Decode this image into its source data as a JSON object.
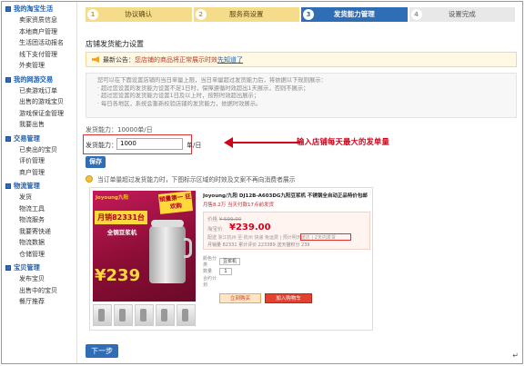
{
  "sidebar": {
    "groups": [
      {
        "title": "我的淘宝生活",
        "items": [
          "卖家资质信息",
          "本地商户管理",
          "生活团活动报名",
          "线下支付管理",
          "外卖管理"
        ]
      },
      {
        "title": "我的网游交易",
        "items": [
          "已卖游戏订单",
          "出售的游戏宝贝",
          "游戏保证金管理",
          "我要出售"
        ]
      },
      {
        "title": "交易管理",
        "items": [
          "已卖出的宝贝",
          "评价管理",
          "商户管理"
        ]
      },
      {
        "title": "物流管理",
        "items": [
          "发货",
          "物流工具",
          "物流服务",
          "我要寄快递",
          "物流数据",
          "仓储管理"
        ]
      },
      {
        "title": "宝贝管理",
        "items": [
          "发布宝贝",
          "出售中的宝贝",
          "餐厅推荐"
        ]
      }
    ]
  },
  "steps": [
    {
      "num": "1",
      "label": "协议确认"
    },
    {
      "num": "2",
      "label": "服务商设置"
    },
    {
      "num": "3",
      "label": "发货能力管理"
    },
    {
      "num": "4",
      "label": "设置完成"
    }
  ],
  "page_title": "店铺发货能力设置",
  "notice": {
    "label": "最新公告：",
    "text": "您店铺的商品将正常展示时效",
    "link": "先知道了"
  },
  "info_rows": [
    "您可以在下面设置店铺的当日单量上限，当日单量超过发货能力后，将依据以下规则展示：",
    "· 超过您设置的发货能力设置不足1日时，保障遵循时效超出1天展示，否则不展示；",
    "· 超过您设置的发货能力设置1日及以上时，按照时效超出展示；",
    "· 每日各地区，系统会重新校验店铺的发货能力，依据时效展示。"
  ],
  "capacity": {
    "current_label": "发货能力：",
    "current_value": "10000单/日",
    "input_label": "发货能力：",
    "input_value": "1000",
    "unit": "单/日"
  },
  "annotation": "输入店铺每天最大的发单量",
  "save_label": "保存",
  "tip": "当订单量超过发货能力时，下图标示区域的时效及文案不再向消费者展示",
  "preview": {
    "brand": "Joyoung九阳",
    "badge": "销量第一 狂欢购",
    "headline": "月销82331台",
    "subline": "全钢豆浆机",
    "hero_price": "¥239",
    "title": "Joyoung/九阳 DJ12B-A603DG九阳豆浆机 不锈钢全自动正品特价包邮",
    "subtitle": "月售8.2万 当天付款17点前发货",
    "old_label": "价格",
    "old_price": "¥ 599.00",
    "now_label": "淘宝价",
    "now_price": "239.00",
    "extra": "配送 浙江杭州 至 杭州 快递 免运费 | 预计明天送达 | 2天内发货",
    "stats": "月销量 82331  累计评价 223389  送天猫积分 239",
    "color_label": "颜色分类",
    "color_value": "豆浆机",
    "qty_label": "数量",
    "qty_value": "1",
    "plan_label": "合约计划",
    "buy_label": "立刻购买",
    "cart_label": "加入购物车"
  },
  "next_label": "下一步",
  "colors": {
    "accent": "#2f6db5",
    "warning": "#d0021b",
    "step_done": "#f4dc8a"
  }
}
